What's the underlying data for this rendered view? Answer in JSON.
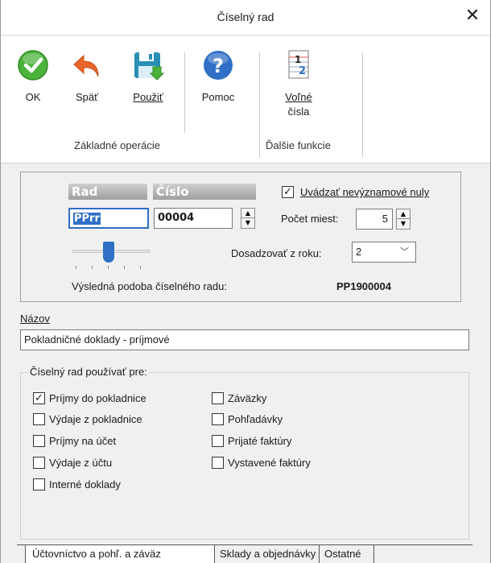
{
  "window": {
    "title": "Číselný rad",
    "close_glyph": "✕"
  },
  "ribbon": {
    "buttons": [
      {
        "label": "OK",
        "icon": "ok-check-icon"
      },
      {
        "label": "Späť",
        "icon": "undo-arrow-icon"
      },
      {
        "label": "Použiť",
        "icon": "save-disk-icon"
      },
      {
        "label": "Pomoc",
        "icon": "help-question-icon"
      },
      {
        "label_line1": "Voľné",
        "label_line2": "čísla",
        "icon": "numbered-list-icon"
      }
    ],
    "groups": [
      "Základné operácie",
      "Ďalšie funkcie"
    ]
  },
  "format": {
    "rad_header": "Rad",
    "cislo_header": "Číslo",
    "rad_value": "PPrr",
    "cislo_value": "00004",
    "leading_zeros_label": "Uvádzať nevýznamové nuly",
    "leading_zeros_checked": true,
    "digit_count_label": "Počet miest:",
    "digit_count_value": "5",
    "year_label": "Dosadzovať z roku:",
    "year_value": "2",
    "result_label": "Výsledná podoba číselného radu:",
    "result_value": "PP1900004"
  },
  "name": {
    "label": "Názov",
    "value": "Pokladničné doklady - príjmové"
  },
  "usage": {
    "legend": "Číselný rad používať pre:",
    "left": [
      {
        "label": "Príjmy do pokladnice",
        "checked": true
      },
      {
        "label": "Výdaje z pokladnice",
        "checked": false
      },
      {
        "label": "Príjmy na účet",
        "checked": false
      },
      {
        "label": "Výdaje z účtu",
        "checked": false
      },
      {
        "label": "Interné doklady",
        "checked": false
      }
    ],
    "right": [
      {
        "label": "Záväzky",
        "checked": false
      },
      {
        "label": "Pohľadávky",
        "checked": false
      },
      {
        "label": "Prijaté faktúry",
        "checked": false
      },
      {
        "label": "Vystavené faktúry",
        "checked": false
      }
    ]
  },
  "tabs": [
    {
      "label": "Účtovníctvo a pohľ. a záväz",
      "active": true
    },
    {
      "label": "Sklady a objednávky",
      "active": false
    },
    {
      "label": "Ostatné",
      "active": false
    }
  ],
  "colors": {
    "accent_green": "#4bb33b",
    "undo_orange": "#e8662a",
    "help_blue": "#2f6fc6",
    "disk_teal": "#2a8fb5"
  }
}
